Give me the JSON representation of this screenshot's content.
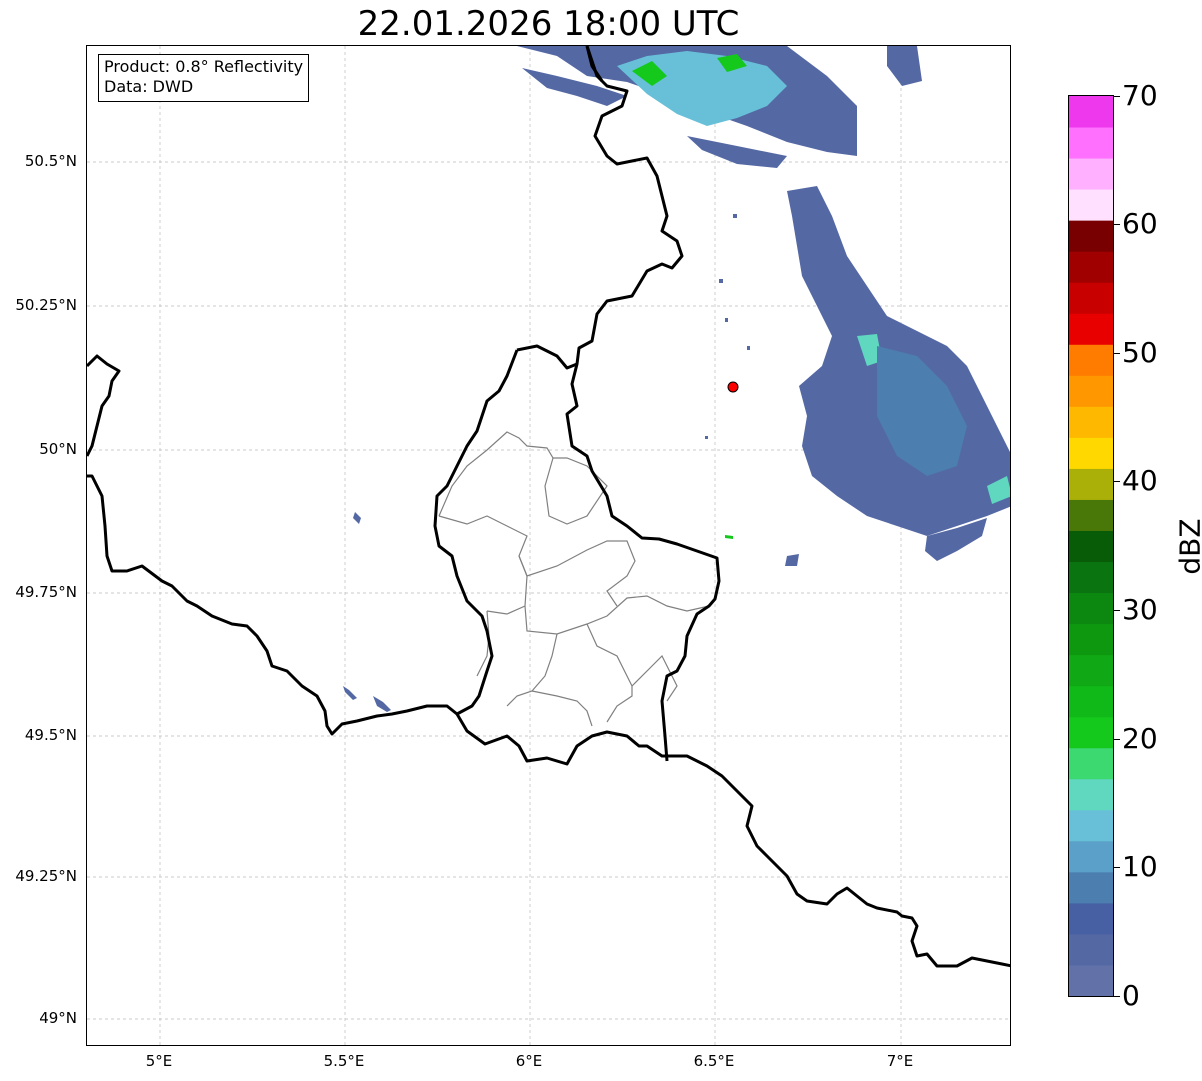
{
  "title": "22.01.2026 18:00 UTC",
  "info": {
    "product": "Product: 0.8° Reflectivity",
    "source": "Data: DWD"
  },
  "axes": {
    "lat_ticks": [
      "50.5°N",
      "50.25°N",
      "50°N",
      "49.75°N",
      "49.5°N",
      "49.25°N",
      "49°N"
    ],
    "lon_ticks": [
      "5°E",
      "5.5°E",
      "6°E",
      "6.5°E",
      "7°E"
    ],
    "lon_range": [
      4.8,
      7.3
    ],
    "lat_range": [
      48.95,
      50.7
    ],
    "grid": true
  },
  "radar_site": {
    "lon": 6.55,
    "lat": 50.11,
    "color": "#ff0000"
  },
  "colorbar": {
    "label": "dBZ",
    "min": 0,
    "max": 70,
    "ticks": [
      "0",
      "10",
      "20",
      "30",
      "40",
      "50",
      "60",
      "70"
    ],
    "colors": [
      "#6272a8",
      "#5468a4",
      "#4760a4",
      "#4c7eb0",
      "#5aa0c8",
      "#68c0d8",
      "#60d8c0",
      "#3cd870",
      "#14c81c",
      "#10b818",
      "#10a814",
      "#0e9810",
      "#0c8810",
      "#0a7410",
      "#085c08",
      "#4a7808",
      "#aab008",
      "#ffd800",
      "#ffb800",
      "#ff9800",
      "#ff7c00",
      "#e80000",
      "#c80000",
      "#a00000",
      "#780000",
      "#ffe0ff",
      "#ffb0ff",
      "#ff70ff",
      "#ee38ee"
    ]
  },
  "legend_colors": {
    "border_country": "#000000",
    "border_canton": "#808080",
    "grid": "#bbbbbb"
  }
}
